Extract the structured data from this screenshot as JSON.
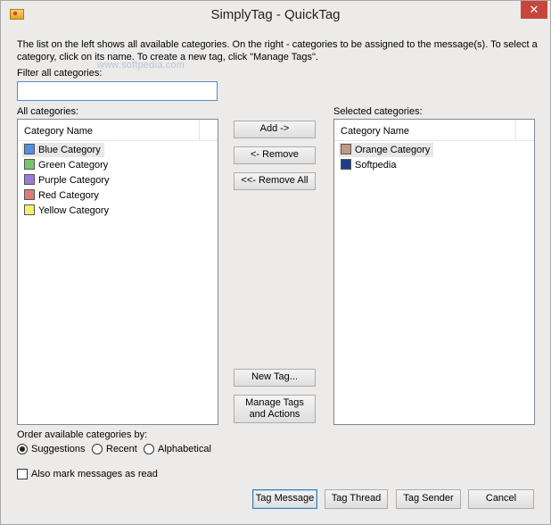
{
  "window": {
    "title": "SimplyTag - QuickTag",
    "close_glyph": "✕"
  },
  "description": "The list on the left shows all available categories. On the right - categories to be assigned to the message(s). To select a category, click on its name. To create a new tag, click \"Manage Tags\".",
  "watermark": "www.softpedia.com",
  "filter": {
    "label": "Filter all categories:",
    "value": ""
  },
  "all_categories": {
    "label": "All categories:",
    "column": "Category Name",
    "items": [
      {
        "name": "Blue Category",
        "color": "#4f8fe0"
      },
      {
        "name": "Green Category",
        "color": "#78c46a"
      },
      {
        "name": "Purple Category",
        "color": "#9a7bd6"
      },
      {
        "name": "Red Category",
        "color": "#e07a7a"
      },
      {
        "name": "Yellow Category",
        "color": "#f5f06a"
      }
    ]
  },
  "selected_categories": {
    "label": "Selected categories:",
    "column": "Category Name",
    "items": [
      {
        "name": "Orange Category",
        "color": "#c09a82"
      },
      {
        "name": "Softpedia",
        "color": "#1f3e8a"
      }
    ]
  },
  "buttons": {
    "add": "Add ->",
    "remove": "<- Remove",
    "remove_all": "<<- Remove All",
    "new_tag": "New Tag...",
    "manage_tags": "Manage Tags and Actions",
    "tag_message": "Tag Message",
    "tag_thread": "Tag Thread",
    "tag_sender": "Tag Sender",
    "cancel": "Cancel"
  },
  "order": {
    "label": "Order available categories by:",
    "options": [
      "Suggestions",
      "Recent",
      "Alphabetical"
    ],
    "selected": "Suggestions"
  },
  "also_mark": {
    "label": "Also mark messages as read",
    "checked": false
  }
}
